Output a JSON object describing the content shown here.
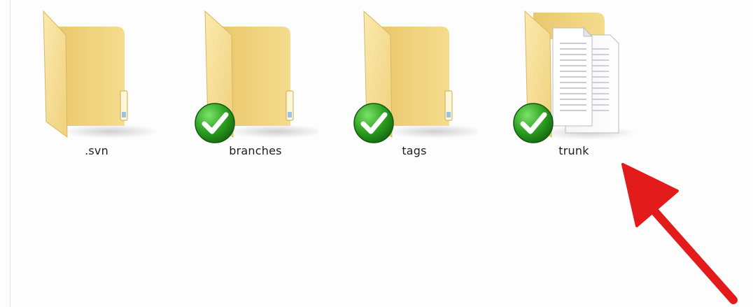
{
  "explorer": {
    "items": [
      {
        "label": ".svn",
        "icon": "folder-icon",
        "status": "none"
      },
      {
        "label": "branches",
        "icon": "folder-icon",
        "status": "normal"
      },
      {
        "label": "tags",
        "icon": "folder-icon",
        "status": "normal"
      },
      {
        "label": "trunk",
        "icon": "folder-with-documents-icon",
        "status": "normal"
      }
    ],
    "overlay": {
      "icon": "svn-normal-checkmark-icon",
      "color": "#2a9d1e"
    },
    "annotation": {
      "icon": "red-arrow-icon",
      "color": "#e31b1b"
    }
  }
}
